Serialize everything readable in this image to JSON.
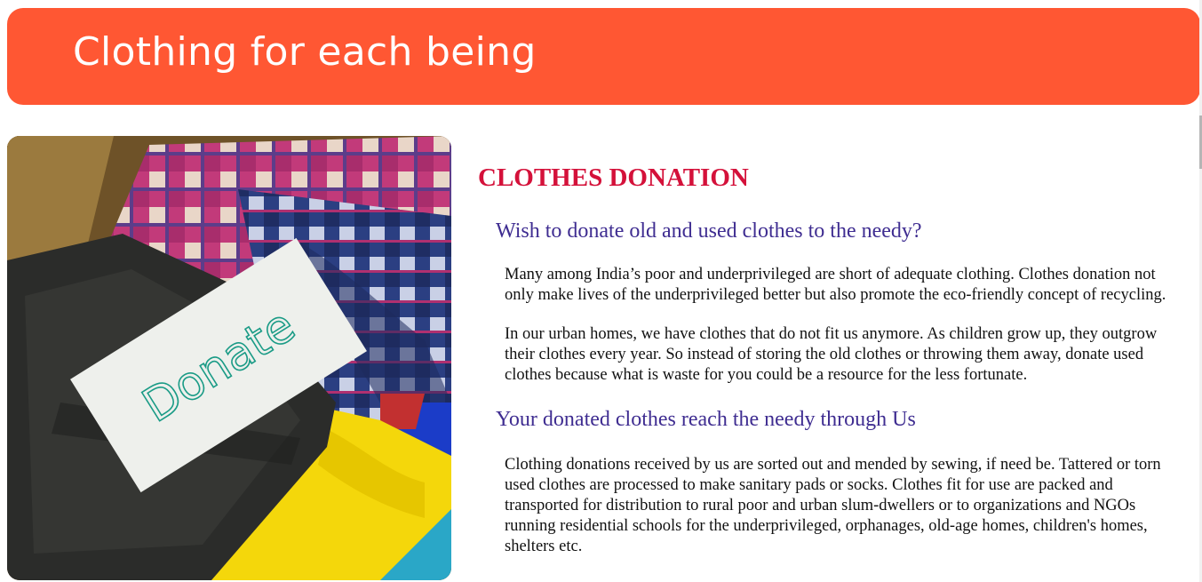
{
  "header": {
    "title": "Clothing for each being"
  },
  "photo": {
    "tag_text": "Donate"
  },
  "content": {
    "section_title": "CLOTHES DONATION",
    "heading_wish": "Wish to donate old and used clothes to the needy?",
    "para_1": "Many among India’s poor and underprivileged are short of adequate clothing. Clothes donation not only make lives of the underprivileged better but also promote the eco-friendly concept of recycling.",
    "para_2": "In our urban homes, we have clothes that do not fit us anymore. As children grow up, they outgrow their clothes every year. So instead of storing the old clothes or throwing them away, donate used clothes because what is waste for you could be a resource for the less fortunate.",
    "heading_reach": "Your donated clothes reach the needy through Us",
    "para_3": "Clothing donations received by us are sorted out and mended by sewing, if need be. Tattered or torn used clothes are processed to make sanitary pads or socks. Clothes fit for use are packed and transported for distribution to rural poor and urban slum-dwellers or to organizations and NGOs running residential schools for the underprivileged, orphanages, old-age homes, children's homes, shelters etc."
  },
  "colors": {
    "header_bg": "#ff5733",
    "section_title": "#d4113a",
    "sub_heading": "#3f2d91"
  }
}
